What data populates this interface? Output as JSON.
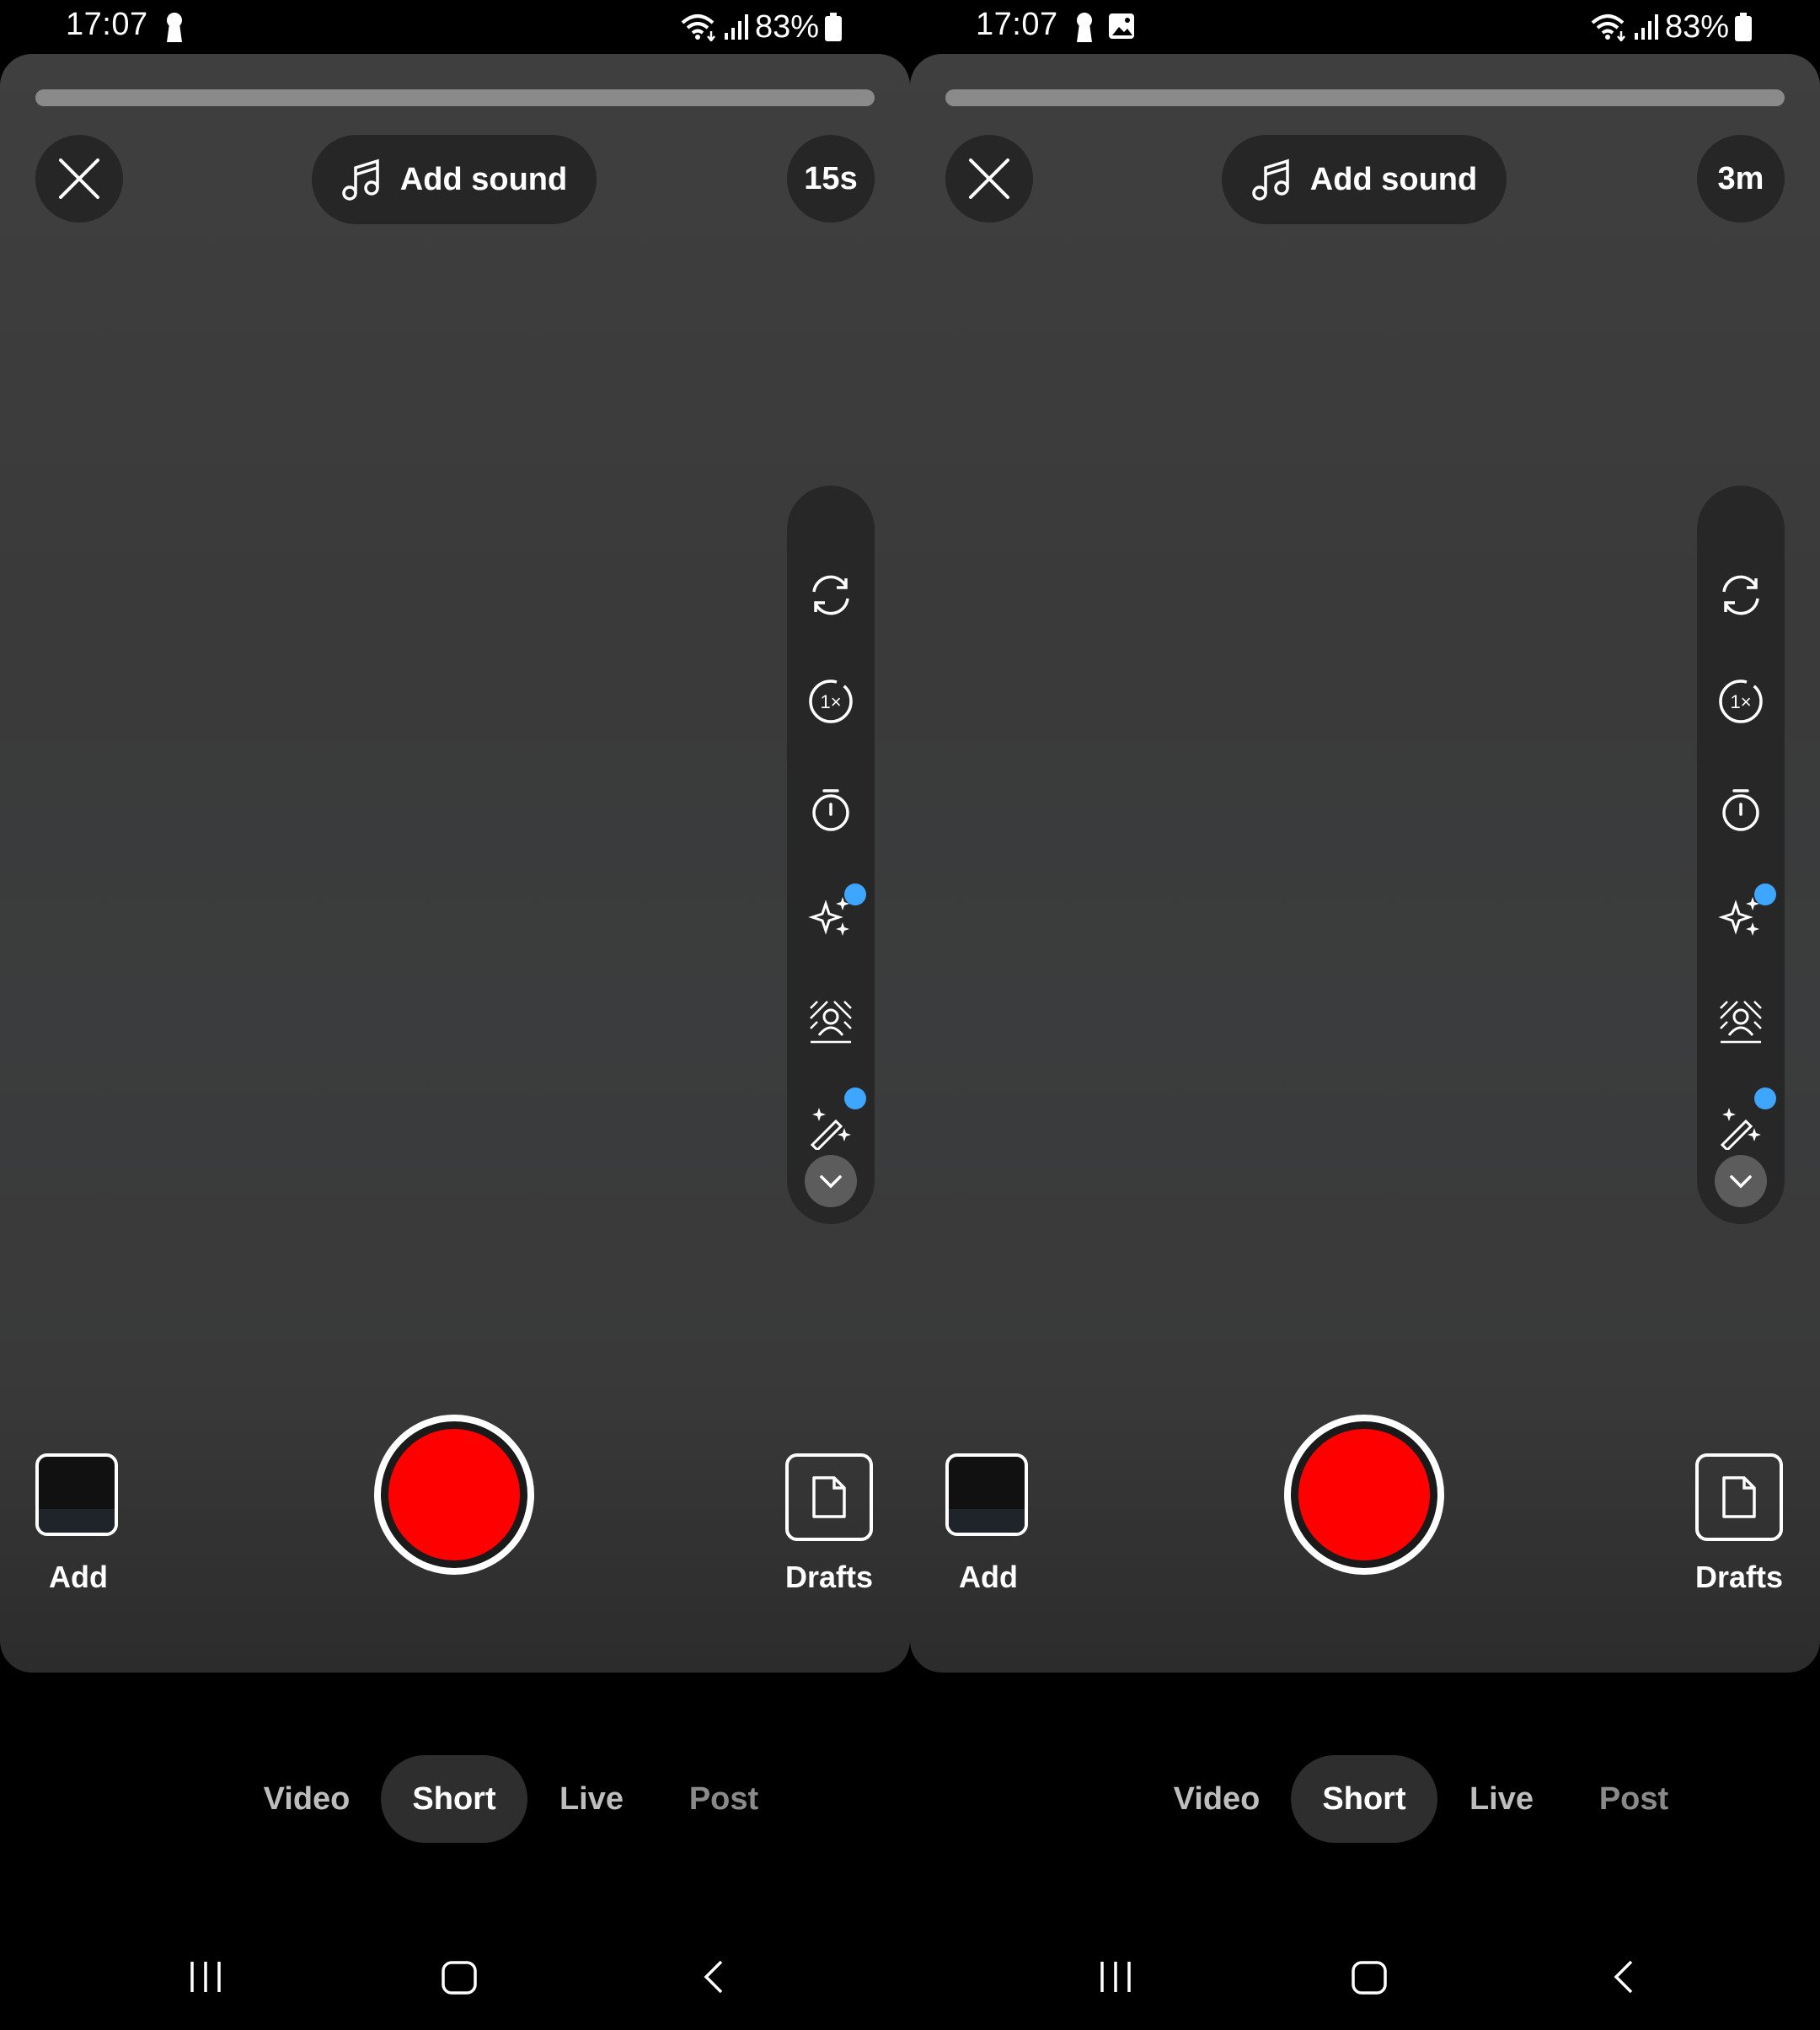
{
  "screens": [
    {
      "status": {
        "time": "17:07",
        "battery": "83%"
      },
      "top": {
        "add_sound": "Add sound",
        "duration": "15s"
      },
      "bottom": {
        "add_label": "Add",
        "drafts_label": "Drafts"
      },
      "modes": [
        "Video",
        "Short",
        "Live",
        "Post"
      ],
      "active_mode": "Short"
    },
    {
      "status": {
        "time": "17:07",
        "battery": "83%"
      },
      "top": {
        "add_sound": "Add sound",
        "duration": "3m"
      },
      "bottom": {
        "add_label": "Add",
        "drafts_label": "Drafts"
      },
      "modes": [
        "Video",
        "Short",
        "Live",
        "Post"
      ],
      "active_mode": "Short"
    }
  ],
  "toolbar_icons": [
    "flip-camera-icon",
    "speed-icon",
    "timer-icon",
    "effects-icon",
    "green-screen-icon",
    "retouch-icon",
    "chevron-down-icon"
  ],
  "colors": {
    "record": "#ff0000",
    "badge": "#3ea6ff",
    "card": "#3b3b3b"
  }
}
